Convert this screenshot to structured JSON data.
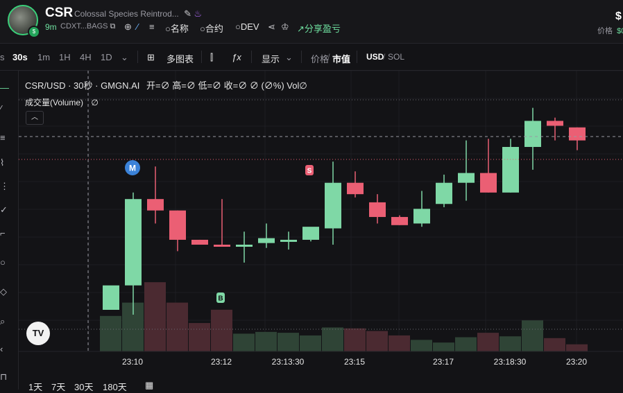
{
  "header": {
    "symbol": "CSR",
    "token_name": "Colossal Species Reintrod...",
    "age": "9m",
    "address": "CDXT...BAGS",
    "links": [
      {
        "icon": "search-icon",
        "label": "名称"
      },
      {
        "icon": "search-icon",
        "label": "合约"
      },
      {
        "icon": "search-icon",
        "label": "DEV"
      }
    ],
    "share_label": "分享盈亏",
    "price_label": "价格",
    "price_value_top": "$",
    "price_value_bottom": "$0"
  },
  "toolbar": {
    "intervals": [
      "s",
      "30s",
      "1m",
      "1H",
      "4H",
      "1D"
    ],
    "active_interval": "30s",
    "multi_chart_label": "多图表",
    "display_label": "显示",
    "price_label": "价格",
    "mcap_label": "市值",
    "currency_usd": "USD",
    "currency_sol": "SOL"
  },
  "chart_legend": {
    "pair": "CSR/USD · 30秒 · GMGN.AI",
    "ohlc": "开=∅ 高=∅ 低=∅ 收=∅ ∅ (∅%) Vol∅",
    "volume_label": "成交量(Volume)",
    "volume_value": "∅"
  },
  "markers": {
    "m": "M",
    "s": "S",
    "b": "B"
  },
  "tv_logo": "TV",
  "ranges": [
    "1天",
    "7天",
    "30天",
    "180天"
  ],
  "colors": {
    "up": "#7fd8a6",
    "down": "#eb5f74",
    "up_vol": "#2f4436",
    "down_vol": "#4b2a31",
    "accent": "#6fe0a0"
  },
  "chart_data": {
    "type": "candlestick",
    "x_tick_labels": [
      "23:10",
      "23:12",
      "23:13:30",
      "23:15",
      "23:17",
      "23:18:30",
      "23:20"
    ],
    "candles": [
      {
        "o": 1,
        "h": 1,
        "l": 1,
        "c": 2.5,
        "v": 4
      },
      {
        "o": 2.5,
        "h": 8.2,
        "l": 0.7,
        "c": 7.8,
        "v": 5.5
      },
      {
        "o": 7.8,
        "h": 9.8,
        "l": 6.3,
        "c": 7.1,
        "v": 7.8
      },
      {
        "o": 7.1,
        "h": 7.1,
        "l": 4.6,
        "c": 5.3,
        "v": 5.5
      },
      {
        "o": 5.3,
        "h": 5.3,
        "l": 5.2,
        "c": 5.0,
        "v": 3.2
      },
      {
        "o": 5.0,
        "h": 7.8,
        "l": 4.9,
        "c": 4.9,
        "v": 4.7
      },
      {
        "o": 4.9,
        "h": 5.8,
        "l": 3.9,
        "c": 5.0,
        "v": 2.0
      },
      {
        "o": 5.1,
        "h": 6.3,
        "l": 4.8,
        "c": 5.4,
        "v": 2.2
      },
      {
        "o": 5.3,
        "h": 5.8,
        "l": 4.7,
        "c": 5.3,
        "v": 2.1
      },
      {
        "o": 5.3,
        "h": 5.3,
        "l": 5.2,
        "c": 6.1,
        "v": 1.8
      },
      {
        "o": 6.0,
        "h": 10.1,
        "l": 5.0,
        "c": 8.8,
        "v": 2.7
      },
      {
        "o": 8.8,
        "h": 9.5,
        "l": 7.9,
        "c": 8.1,
        "v": 2.6
      },
      {
        "o": 7.6,
        "h": 8.1,
        "l": 6.3,
        "c": 6.7,
        "v": 2.3
      },
      {
        "o": 6.7,
        "h": 6.8,
        "l": 6.2,
        "c": 6.2,
        "v": 1.8
      },
      {
        "o": 6.3,
        "h": 8.3,
        "l": 6.1,
        "c": 7.2,
        "v": 1.3
      },
      {
        "o": 7.5,
        "h": 9.3,
        "l": 7.3,
        "c": 8.8,
        "v": 1.0
      },
      {
        "o": 8.8,
        "h": 11.4,
        "l": 7.7,
        "c": 9.4,
        "v": 1.6
      },
      {
        "o": 9.4,
        "h": 11.5,
        "l": 8.2,
        "c": 8.2,
        "v": 2.1
      },
      {
        "o": 8.2,
        "h": 11.5,
        "l": 8.2,
        "c": 11.0,
        "v": 1.7
      },
      {
        "o": 11.0,
        "h": 13.4,
        "l": 9.6,
        "c": 12.6,
        "v": 3.5
      },
      {
        "o": 12.6,
        "h": 12.8,
        "l": 11.4,
        "c": 12.3,
        "v": 1.5
      },
      {
        "o": 12.2,
        "h": 12.2,
        "l": 10.8,
        "c": 11.4,
        "v": 0.8
      }
    ]
  }
}
